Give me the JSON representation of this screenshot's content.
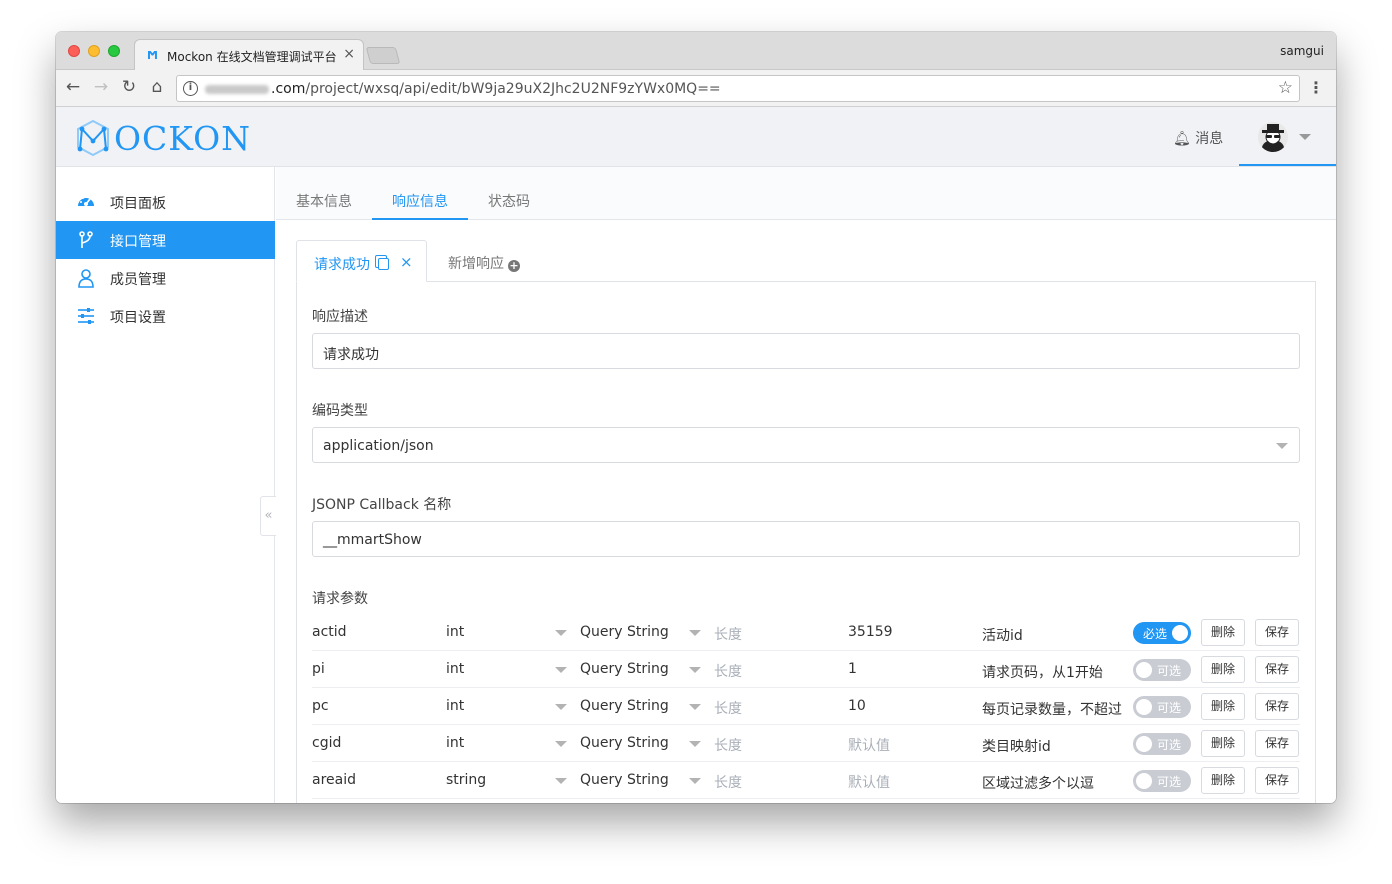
{
  "browser": {
    "tab_title": "Mockon 在线文档管理调试平台",
    "user": "samgui",
    "url_domain_suffix": ".com",
    "url_path": "/project/wxsq/api/edit/bW9ja29uX2Jhc2U2NF9zYWx0MQ=="
  },
  "header": {
    "logo": "MOCKON",
    "messages_label": "消息"
  },
  "sidebar": {
    "items": [
      {
        "label": "项目面板",
        "icon": "dashboard-icon"
      },
      {
        "label": "接口管理",
        "icon": "branch-icon",
        "active": true
      },
      {
        "label": "成员管理",
        "icon": "user-icon"
      },
      {
        "label": "项目设置",
        "icon": "sliders-icon"
      }
    ],
    "collapse_glyph": "«"
  },
  "main": {
    "tabs": [
      "基本信息",
      "响应信息",
      "状态码"
    ],
    "active_tab": "响应信息",
    "response_tabs": {
      "active": "请求成功",
      "add": "新增响应"
    },
    "form": {
      "desc_label": "响应描述",
      "desc_value": "请求成功",
      "encoding_label": "编码类型",
      "encoding_value": "application/json",
      "jsonp_label": "JSONP Callback 名称",
      "jsonp_value": "__mmartShow",
      "params_label": "请求参数"
    },
    "params": [
      {
        "name": "actid",
        "type": "int",
        "location": "Query String",
        "length": "长度",
        "default": "35159",
        "default_is_placeholder": false,
        "desc": "活动id",
        "required": true,
        "toggle": "必选"
      },
      {
        "name": "pi",
        "type": "int",
        "location": "Query String",
        "length": "长度",
        "default": "1",
        "default_is_placeholder": false,
        "desc": "请求页码，从1开始",
        "required": false,
        "toggle": "可选"
      },
      {
        "name": "pc",
        "type": "int",
        "location": "Query String",
        "length": "长度",
        "default": "10",
        "default_is_placeholder": false,
        "desc": "每页记录数量，不超过",
        "required": false,
        "toggle": "可选"
      },
      {
        "name": "cgid",
        "type": "int",
        "location": "Query String",
        "length": "长度",
        "default": "默认值",
        "default_is_placeholder": true,
        "desc": "类目映射id",
        "required": false,
        "toggle": "可选"
      },
      {
        "name": "areaid",
        "type": "string",
        "location": "Query String",
        "length": "长度",
        "default": "默认值",
        "default_is_placeholder": true,
        "desc": "区域过滤多个以逗",
        "required": false,
        "toggle": "可选"
      }
    ],
    "row_buttons": {
      "delete": "删除",
      "save": "保存"
    }
  },
  "colors": {
    "accent": "#2196f3",
    "toggle_off": "#c9cdd3"
  }
}
